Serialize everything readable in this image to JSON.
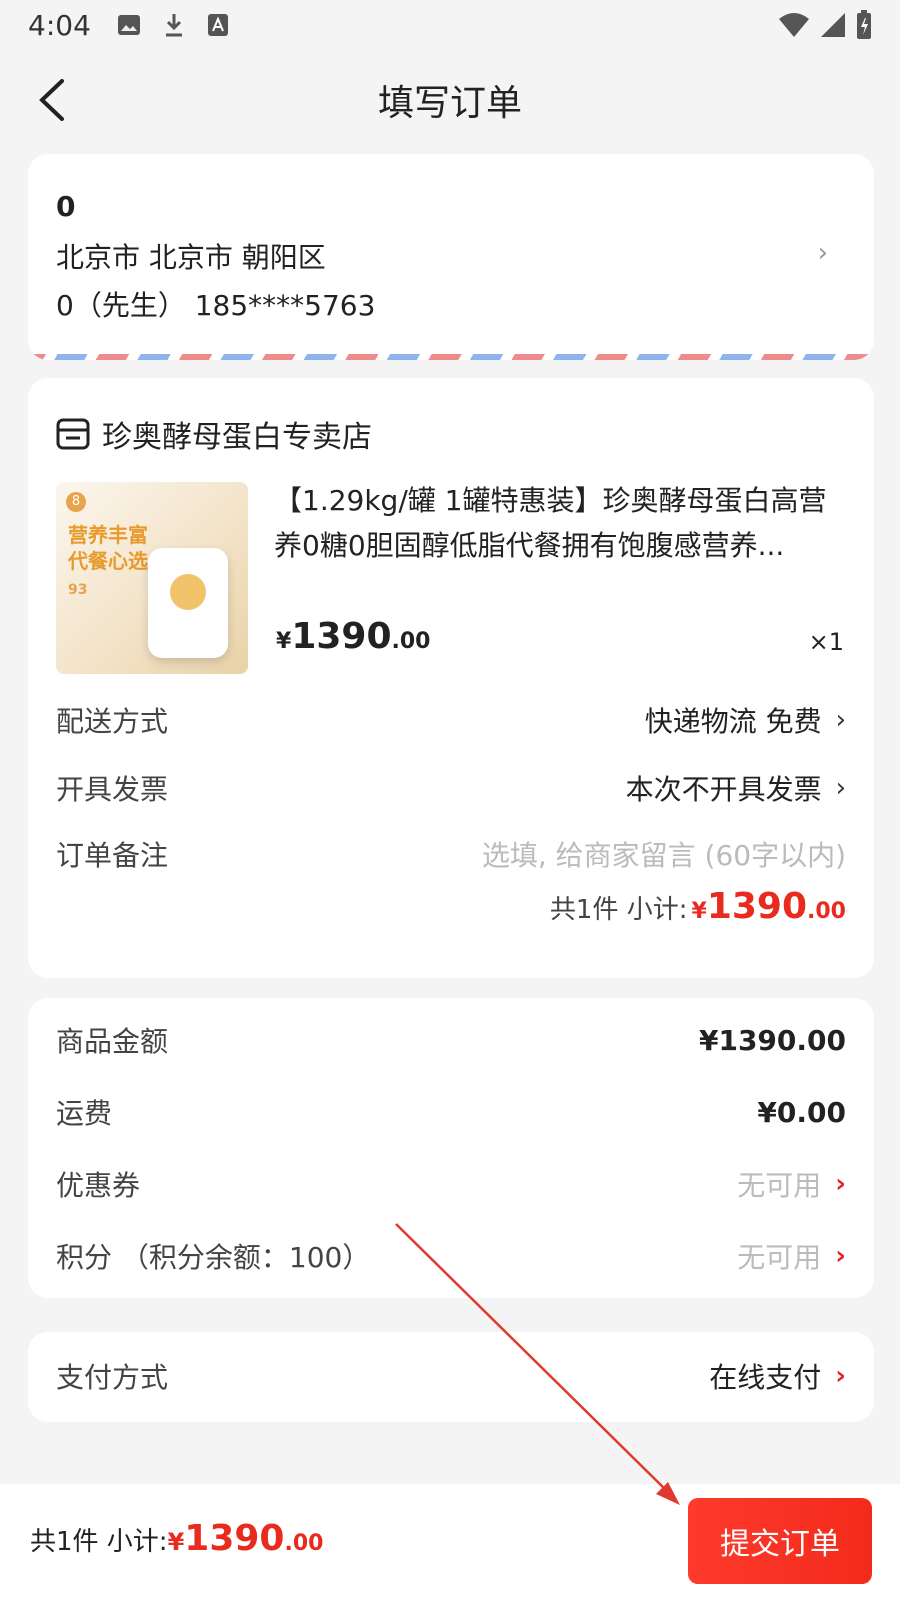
{
  "status_bar": {
    "time": "4:04"
  },
  "nav": {
    "title": "填写订单"
  },
  "address": {
    "name": "0",
    "region": "北京市 北京市 朝阳区",
    "contact": "0（先生） 185****5763"
  },
  "shop": {
    "name": "珍奥酵母蛋白专卖店",
    "product": {
      "title": "【1.29kg/罐 1罐特惠装】珍奥酵母蛋白高营养0糖0胆固醇低脂代餐拥有饱腹感营养...",
      "thumb_text": "营养丰富\n代餐心选",
      "thumb_badge": "8",
      "thumb_num": "93",
      "price_symbol": "¥",
      "price_int": "1390",
      "price_dec": ".00",
      "quantity": "×1"
    },
    "delivery": {
      "label": "配送方式",
      "value": "快递物流 免费"
    },
    "invoice": {
      "label": "开具发票",
      "value": "本次不开具发票"
    },
    "remark": {
      "label": "订单备注",
      "placeholder": "选填, 给商家留言 (60字以内)"
    },
    "subtotal": {
      "prefix": "共1件 小计:",
      "symbol": "¥",
      "int": "1390",
      "dec": ".00"
    }
  },
  "summary": {
    "goods_amount": {
      "label": "商品金额",
      "value": "¥1390.00"
    },
    "shipping": {
      "label": "运费",
      "value": "¥0.00"
    },
    "coupon": {
      "label": "优惠券",
      "value": "无可用"
    },
    "points": {
      "label": "积分 （积分余额：100）",
      "value": "无可用"
    }
  },
  "payment": {
    "label": "支付方式",
    "value": "在线支付"
  },
  "bottom": {
    "prefix": "共1件 小计:",
    "symbol": "¥",
    "int": "1390",
    "dec": ".00",
    "submit_label": "提交订单"
  },
  "colors": {
    "accent": "#e82b1e",
    "submit_bg": "#f22b1b",
    "annotation": "#e03a2e"
  },
  "icons": [
    "image-icon",
    "download-icon",
    "font-icon",
    "wifi-icon",
    "signal-icon",
    "battery-icon",
    "back-icon",
    "shop-icon",
    "chevron-right-icon"
  ]
}
